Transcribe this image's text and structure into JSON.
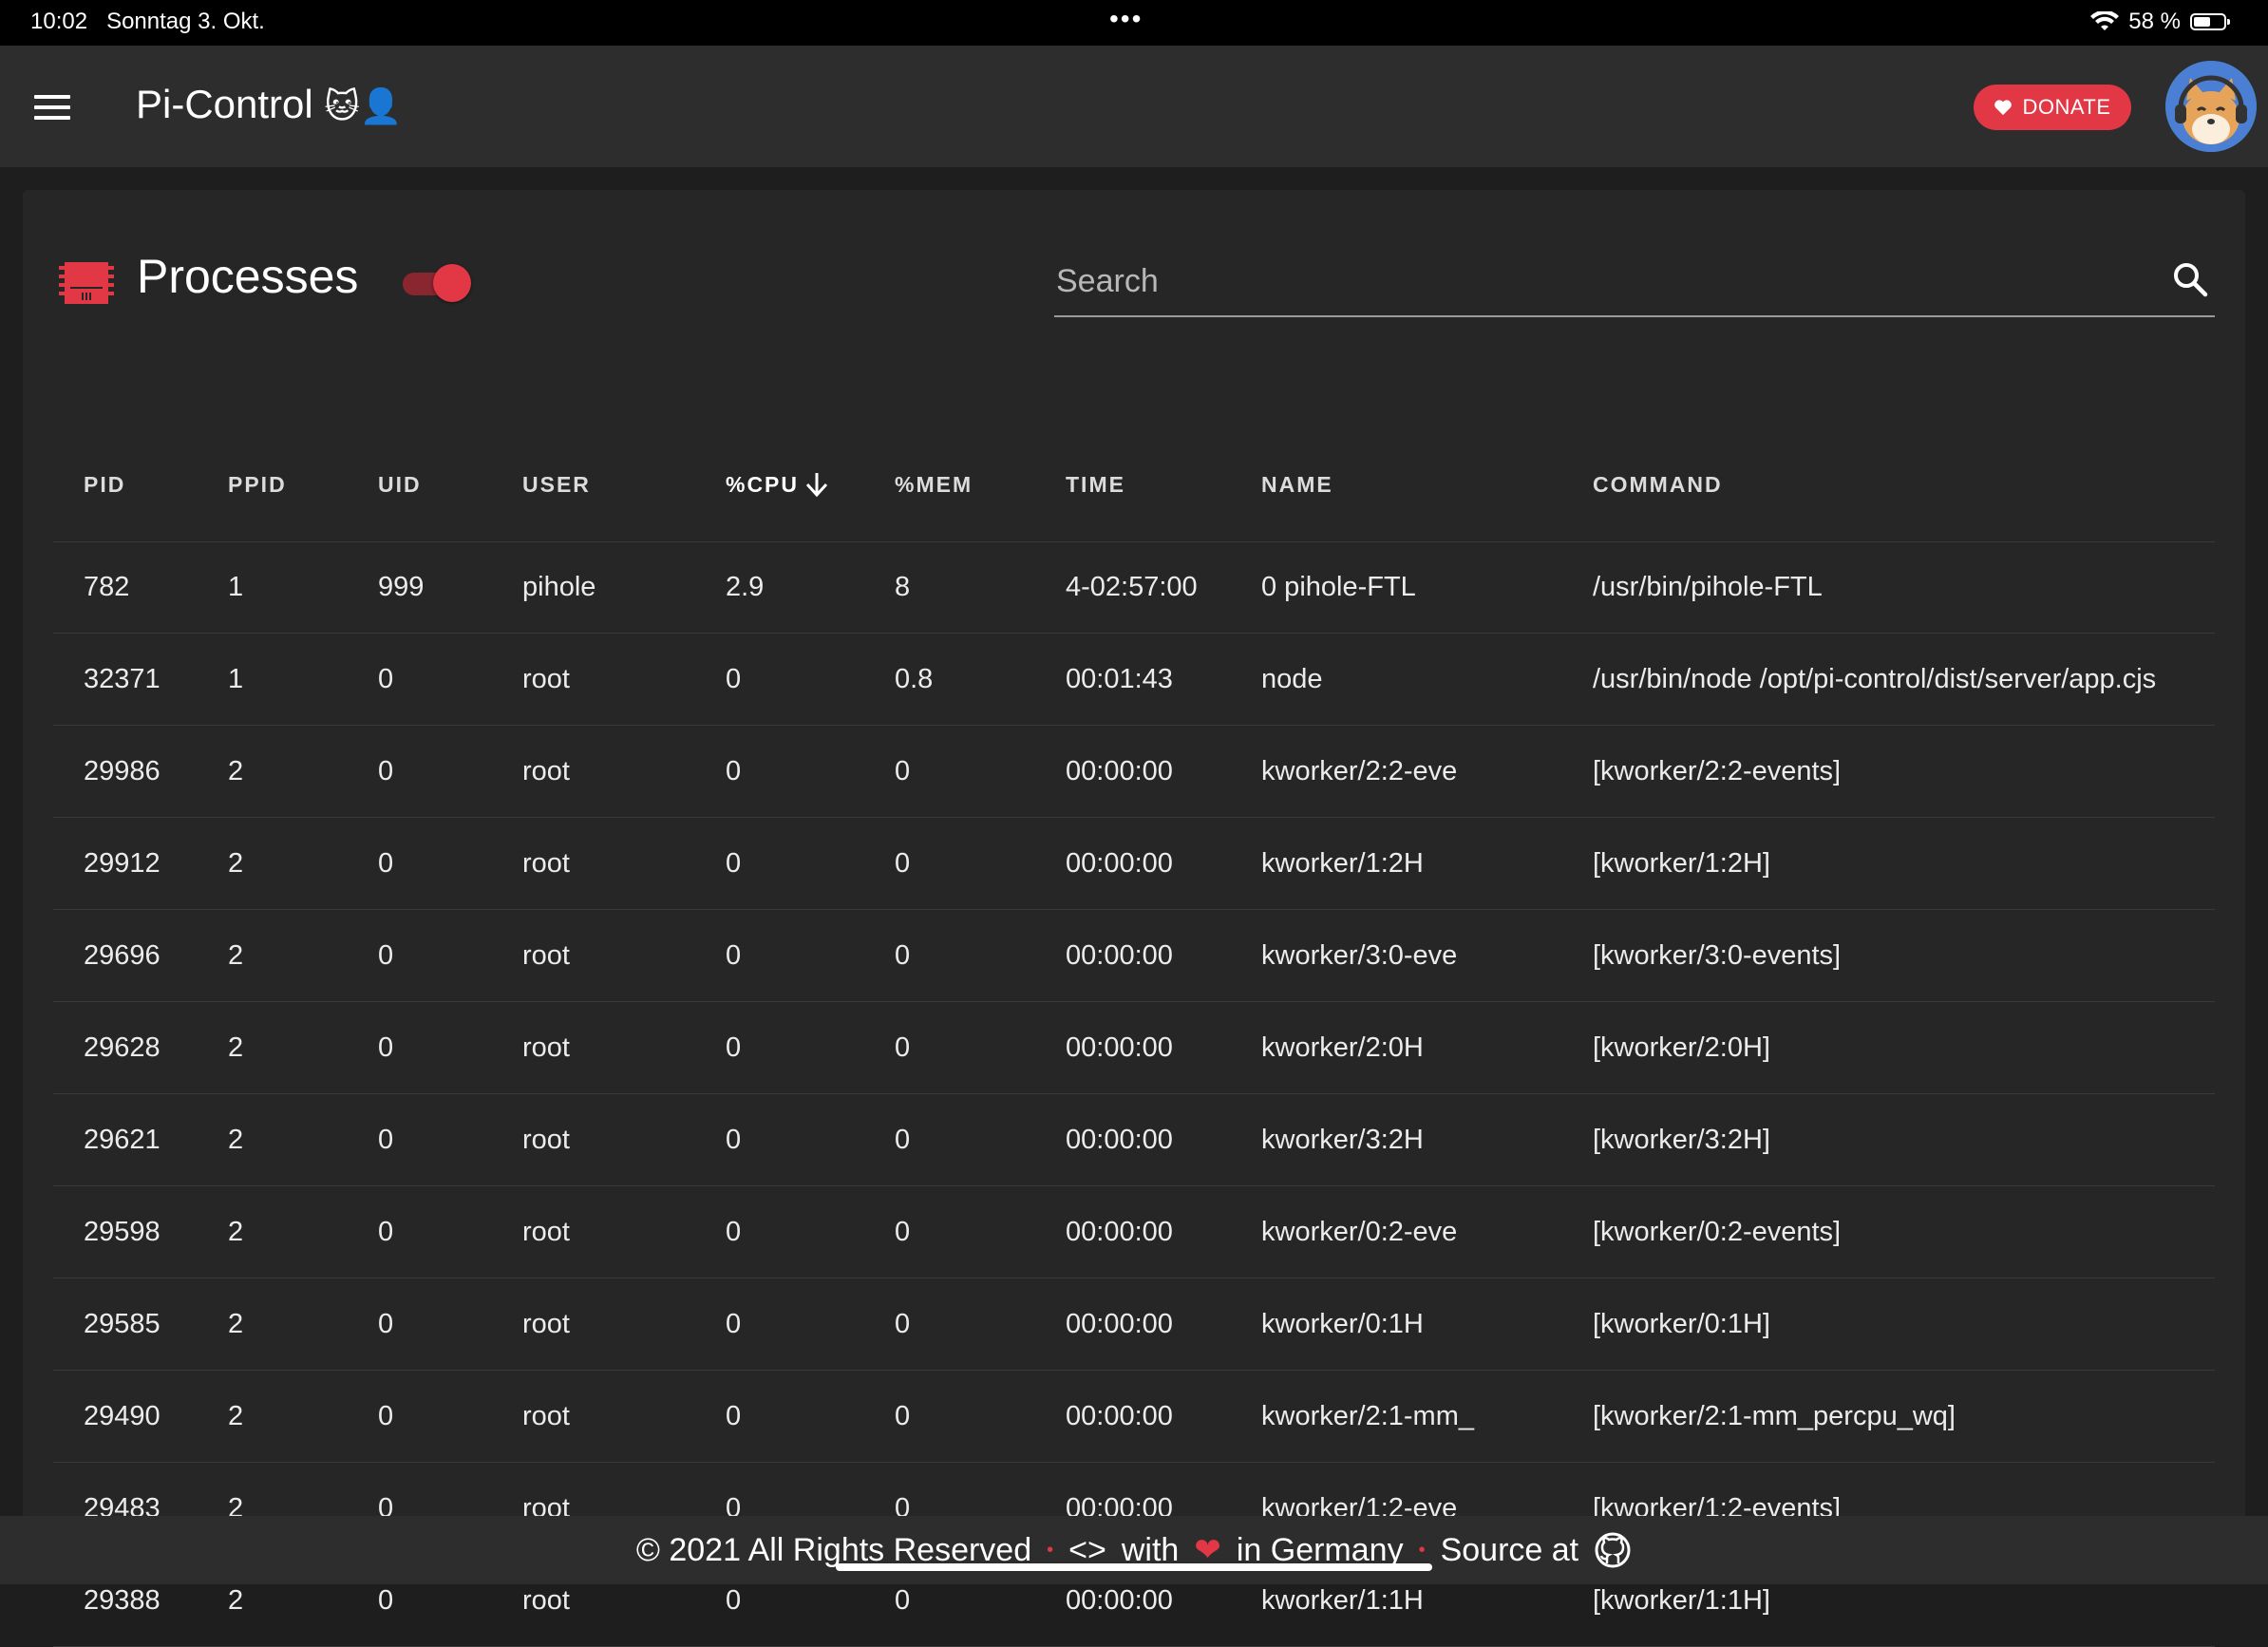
{
  "status_bar": {
    "time": "10:02",
    "date": "Sonntag 3. Okt.",
    "multitask_dots": "•••",
    "battery_label": "58 %",
    "battery_level": 0.58
  },
  "app_bar": {
    "title": "Pi-Control",
    "title_emoji": "🐱👤",
    "donate_label": "DONATE"
  },
  "card": {
    "title": "Processes",
    "toggle_on": true,
    "search_placeholder": "Search"
  },
  "table": {
    "columns": [
      "PID",
      "PPID",
      "UID",
      "USER",
      "%CPU",
      "%MEM",
      "TIME",
      "NAME",
      "COMMAND"
    ],
    "sorted_column": "%CPU",
    "sort_direction": "descending",
    "rows": [
      [
        "782",
        "1",
        "999",
        "pihole",
        "2.9",
        "8",
        "4-02:57:00",
        "0 pihole-FTL",
        "/usr/bin/pihole-FTL"
      ],
      [
        "32371",
        "1",
        "0",
        "root",
        "0",
        "0.8",
        "00:01:43",
        "node",
        "/usr/bin/node /opt/pi-control/dist/server/app.cjs"
      ],
      [
        "29986",
        "2",
        "0",
        "root",
        "0",
        "0",
        "00:00:00",
        "kworker/2:2-eve",
        "[kworker/2:2-events]"
      ],
      [
        "29912",
        "2",
        "0",
        "root",
        "0",
        "0",
        "00:00:00",
        "kworker/1:2H",
        "[kworker/1:2H]"
      ],
      [
        "29696",
        "2",
        "0",
        "root",
        "0",
        "0",
        "00:00:00",
        "kworker/3:0-eve",
        "[kworker/3:0-events]"
      ],
      [
        "29628",
        "2",
        "0",
        "root",
        "0",
        "0",
        "00:00:00",
        "kworker/2:0H",
        "[kworker/2:0H]"
      ],
      [
        "29621",
        "2",
        "0",
        "root",
        "0",
        "0",
        "00:00:00",
        "kworker/3:2H",
        "[kworker/3:2H]"
      ],
      [
        "29598",
        "2",
        "0",
        "root",
        "0",
        "0",
        "00:00:00",
        "kworker/0:2-eve",
        "[kworker/0:2-events]"
      ],
      [
        "29585",
        "2",
        "0",
        "root",
        "0",
        "0",
        "00:00:00",
        "kworker/0:1H",
        "[kworker/0:1H]"
      ],
      [
        "29490",
        "2",
        "0",
        "root",
        "0",
        "0",
        "00:00:00",
        "kworker/2:1-mm_",
        "[kworker/2:1-mm_percpu_wq]"
      ],
      [
        "29483",
        "2",
        "0",
        "root",
        "0",
        "0",
        "00:00:00",
        "kworker/1:2-eve",
        "[kworker/1:2-events]"
      ],
      [
        "29388",
        "2",
        "0",
        "root",
        "0",
        "0",
        "00:00:00",
        "kworker/1:1H",
        "[kworker/1:1H]"
      ]
    ]
  },
  "footer": {
    "copyright": "© 2021 All Rights Reserved",
    "code_glyph": "<>",
    "with_label": "with",
    "heart": "❤",
    "germany_label": "in Germany",
    "source_label": "Source at",
    "separator": "•"
  },
  "colors": {
    "accent": "#e23744",
    "background": "#1e1e1e",
    "card": "#262626",
    "appbar": "#2d2d2d"
  },
  "icons": [
    "menu-icon",
    "cpu-chip-icon",
    "search-icon",
    "heart-icon",
    "github-icon",
    "wifi-icon",
    "battery-icon",
    "sort-down-arrow-icon",
    "code-icon"
  ]
}
